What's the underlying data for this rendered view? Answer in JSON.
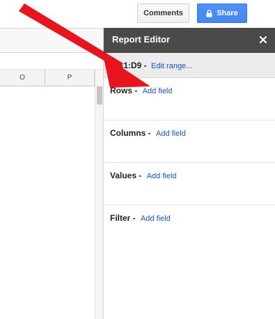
{
  "topbar": {
    "comments_label": "Comments",
    "share_label": "Share",
    "share_icon": "lock-icon"
  },
  "sheet": {
    "columns": [
      "O",
      "P"
    ]
  },
  "editor": {
    "title": "Report Editor",
    "close_icon": "close-icon",
    "range": {
      "ref": "1!A1:D9 -",
      "edit_link": "Edit range..."
    },
    "sections": {
      "rows": {
        "label": "Rows -",
        "link": "Add field"
      },
      "columns": {
        "label": "Columns -",
        "link": "Add field"
      },
      "values": {
        "label": "Values -",
        "link": "Add field"
      },
      "filter": {
        "label": "Filter -",
        "link": "Add field"
      }
    }
  },
  "colors": {
    "accent": "#4d90fe",
    "link": "#1155cc",
    "header": "#4a4a4a",
    "arrow": "#e8141e"
  }
}
